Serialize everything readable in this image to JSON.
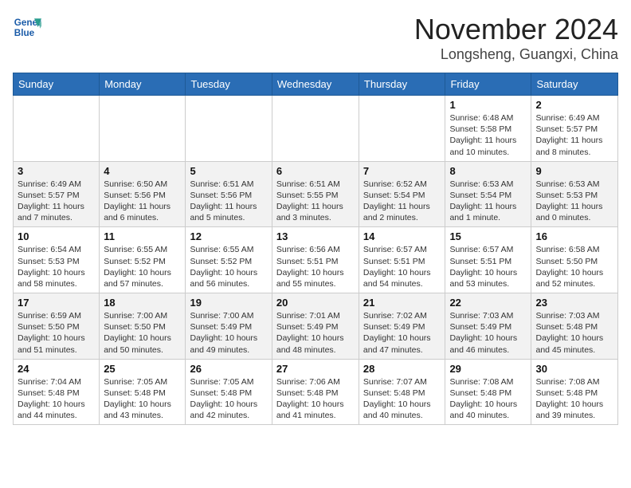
{
  "header": {
    "logo_line1": "General",
    "logo_line2": "Blue",
    "title": "November 2024",
    "subtitle": "Longsheng, Guangxi, China"
  },
  "weekdays": [
    "Sunday",
    "Monday",
    "Tuesday",
    "Wednesday",
    "Thursday",
    "Friday",
    "Saturday"
  ],
  "weeks": [
    [
      {
        "day": "",
        "info": ""
      },
      {
        "day": "",
        "info": ""
      },
      {
        "day": "",
        "info": ""
      },
      {
        "day": "",
        "info": ""
      },
      {
        "day": "",
        "info": ""
      },
      {
        "day": "1",
        "info": "Sunrise: 6:48 AM\nSunset: 5:58 PM\nDaylight: 11 hours and 10 minutes."
      },
      {
        "day": "2",
        "info": "Sunrise: 6:49 AM\nSunset: 5:57 PM\nDaylight: 11 hours and 8 minutes."
      }
    ],
    [
      {
        "day": "3",
        "info": "Sunrise: 6:49 AM\nSunset: 5:57 PM\nDaylight: 11 hours and 7 minutes."
      },
      {
        "day": "4",
        "info": "Sunrise: 6:50 AM\nSunset: 5:56 PM\nDaylight: 11 hours and 6 minutes."
      },
      {
        "day": "5",
        "info": "Sunrise: 6:51 AM\nSunset: 5:56 PM\nDaylight: 11 hours and 5 minutes."
      },
      {
        "day": "6",
        "info": "Sunrise: 6:51 AM\nSunset: 5:55 PM\nDaylight: 11 hours and 3 minutes."
      },
      {
        "day": "7",
        "info": "Sunrise: 6:52 AM\nSunset: 5:54 PM\nDaylight: 11 hours and 2 minutes."
      },
      {
        "day": "8",
        "info": "Sunrise: 6:53 AM\nSunset: 5:54 PM\nDaylight: 11 hours and 1 minute."
      },
      {
        "day": "9",
        "info": "Sunrise: 6:53 AM\nSunset: 5:53 PM\nDaylight: 11 hours and 0 minutes."
      }
    ],
    [
      {
        "day": "10",
        "info": "Sunrise: 6:54 AM\nSunset: 5:53 PM\nDaylight: 10 hours and 58 minutes."
      },
      {
        "day": "11",
        "info": "Sunrise: 6:55 AM\nSunset: 5:52 PM\nDaylight: 10 hours and 57 minutes."
      },
      {
        "day": "12",
        "info": "Sunrise: 6:55 AM\nSunset: 5:52 PM\nDaylight: 10 hours and 56 minutes."
      },
      {
        "day": "13",
        "info": "Sunrise: 6:56 AM\nSunset: 5:51 PM\nDaylight: 10 hours and 55 minutes."
      },
      {
        "day": "14",
        "info": "Sunrise: 6:57 AM\nSunset: 5:51 PM\nDaylight: 10 hours and 54 minutes."
      },
      {
        "day": "15",
        "info": "Sunrise: 6:57 AM\nSunset: 5:51 PM\nDaylight: 10 hours and 53 minutes."
      },
      {
        "day": "16",
        "info": "Sunrise: 6:58 AM\nSunset: 5:50 PM\nDaylight: 10 hours and 52 minutes."
      }
    ],
    [
      {
        "day": "17",
        "info": "Sunrise: 6:59 AM\nSunset: 5:50 PM\nDaylight: 10 hours and 51 minutes."
      },
      {
        "day": "18",
        "info": "Sunrise: 7:00 AM\nSunset: 5:50 PM\nDaylight: 10 hours and 50 minutes."
      },
      {
        "day": "19",
        "info": "Sunrise: 7:00 AM\nSunset: 5:49 PM\nDaylight: 10 hours and 49 minutes."
      },
      {
        "day": "20",
        "info": "Sunrise: 7:01 AM\nSunset: 5:49 PM\nDaylight: 10 hours and 48 minutes."
      },
      {
        "day": "21",
        "info": "Sunrise: 7:02 AM\nSunset: 5:49 PM\nDaylight: 10 hours and 47 minutes."
      },
      {
        "day": "22",
        "info": "Sunrise: 7:03 AM\nSunset: 5:49 PM\nDaylight: 10 hours and 46 minutes."
      },
      {
        "day": "23",
        "info": "Sunrise: 7:03 AM\nSunset: 5:48 PM\nDaylight: 10 hours and 45 minutes."
      }
    ],
    [
      {
        "day": "24",
        "info": "Sunrise: 7:04 AM\nSunset: 5:48 PM\nDaylight: 10 hours and 44 minutes."
      },
      {
        "day": "25",
        "info": "Sunrise: 7:05 AM\nSunset: 5:48 PM\nDaylight: 10 hours and 43 minutes."
      },
      {
        "day": "26",
        "info": "Sunrise: 7:05 AM\nSunset: 5:48 PM\nDaylight: 10 hours and 42 minutes."
      },
      {
        "day": "27",
        "info": "Sunrise: 7:06 AM\nSunset: 5:48 PM\nDaylight: 10 hours and 41 minutes."
      },
      {
        "day": "28",
        "info": "Sunrise: 7:07 AM\nSunset: 5:48 PM\nDaylight: 10 hours and 40 minutes."
      },
      {
        "day": "29",
        "info": "Sunrise: 7:08 AM\nSunset: 5:48 PM\nDaylight: 10 hours and 40 minutes."
      },
      {
        "day": "30",
        "info": "Sunrise: 7:08 AM\nSunset: 5:48 PM\nDaylight: 10 hours and 39 minutes."
      }
    ]
  ]
}
